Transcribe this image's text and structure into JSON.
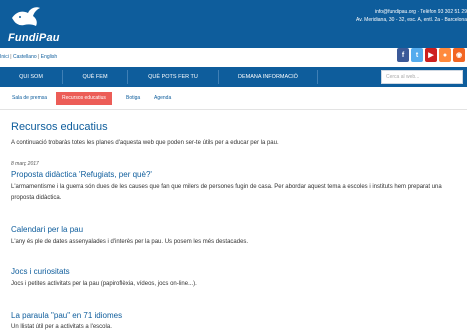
{
  "header": {
    "logo_text": "FundiPau",
    "contact_line1": "info@fundipau.org · Telèfon 93 302 51 29",
    "contact_line2": "Av. Meridiana, 30 - 32, esc. A, entl. 2a - Barcelona"
  },
  "langbar": {
    "home": "Inici",
    "castellano": "Castellano",
    "english": "English",
    "sep": "|"
  },
  "social": [
    {
      "icon": "facebook-icon",
      "glyph": "f",
      "color": "#3b5998"
    },
    {
      "icon": "twitter-icon",
      "glyph": "t",
      "color": "#55acee"
    },
    {
      "icon": "youtube-icon",
      "glyph": "▶",
      "color": "#cd201f"
    },
    {
      "icon": "flickr-icon",
      "glyph": "●",
      "color": "#ff8a3d"
    },
    {
      "icon": "rss-icon",
      "glyph": "◉",
      "color": "#f26522"
    }
  ],
  "nav": {
    "items": [
      "QUI SOM",
      "QUÈ FEM",
      "QUÈ POTS FER TU",
      "DEMANA INFORMACIÓ"
    ],
    "search_placeholder": "Cerca al web..."
  },
  "subnav": {
    "items": [
      "Sala de premsa",
      "Recursos educatius",
      "Botiga",
      "Agenda"
    ],
    "active": "Recursos educatius"
  },
  "main": {
    "title": "Recursos educatius",
    "intro": "A continuació trobaràs totes les planes d'aquesta web que poden ser-te útils per a educar per la pau.",
    "date": "8 març 2017",
    "articles": [
      {
        "title": "Proposta didàctica 'Refugiats, per què?'",
        "text": "L'armamentisme i la guerra són dues de les causes que fan que milers de persones fugin de casa. Per abordar aquest tema a escoles i instituts hem preparat una proposta didàctica."
      },
      {
        "title": "Calendari per la pau",
        "text": "L'any és ple de dates assenyalades i d'interès per la pau. Us posem les més destacades."
      },
      {
        "title": "Jocs i curiositats",
        "text": "Jocs i petites activitats per la pau (papiroflèxia, vídeos, jocs on-line...)."
      },
      {
        "title": "La paraula \"pau\" en 71 idiomes",
        "text": "Un llistat útil per a activitats a l'escola."
      }
    ]
  }
}
